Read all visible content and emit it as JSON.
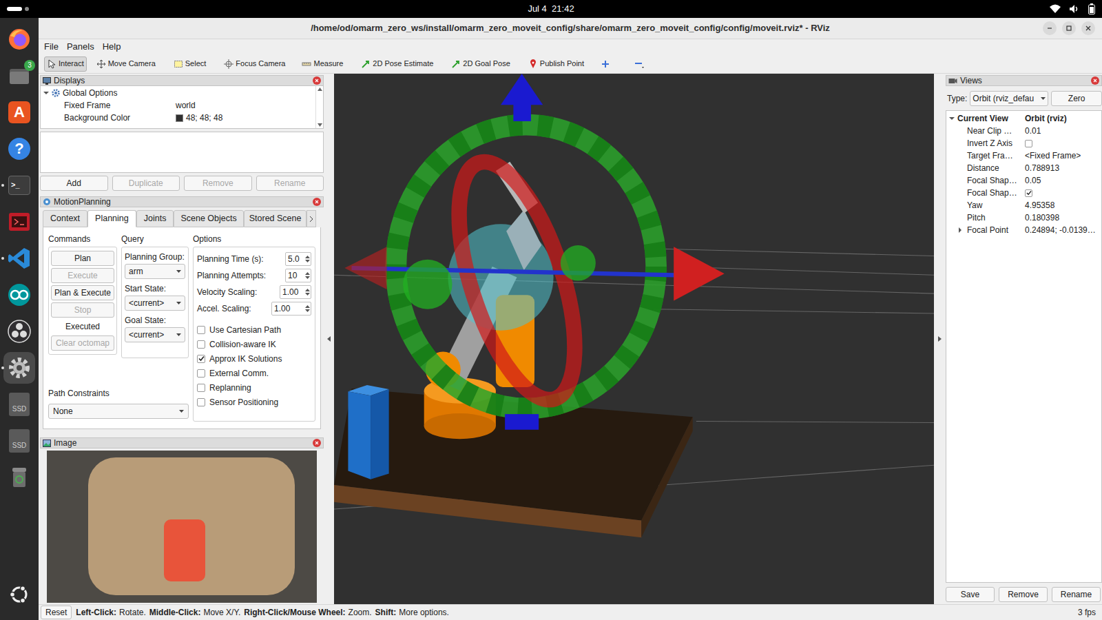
{
  "topbar": {
    "clock": "Jul 4  21:42"
  },
  "dock": {
    "badge": "3",
    "items": [
      {
        "running": false,
        "selected": false
      },
      {
        "running": false,
        "selected": false
      },
      {
        "running": false,
        "selected": false,
        "glyph": "A"
      },
      {
        "running": false,
        "selected": false,
        "glyph": "?"
      },
      {
        "running": true,
        "selected": false,
        "glyph": ">_"
      },
      {
        "running": false,
        "selected": false
      },
      {
        "running": true,
        "selected": false
      },
      {
        "running": false,
        "selected": false
      },
      {
        "running": false,
        "selected": false
      },
      {
        "running": true,
        "selected": true
      },
      {
        "running": false,
        "selected": false,
        "label": "SSD"
      },
      {
        "running": false,
        "selected": false,
        "label": "SSD"
      },
      {
        "running": false,
        "selected": false
      }
    ]
  },
  "window": {
    "title": "/home/od/omarm_zero_ws/install/omarm_zero_moveit_config/share/omarm_zero_moveit_config/config/moveit.rviz* - RViz"
  },
  "menu": [
    "File",
    "Panels",
    "Help"
  ],
  "toolbar": [
    {
      "label": "Interact",
      "selected": true
    },
    {
      "label": "Move Camera",
      "selected": false
    },
    {
      "label": "Select",
      "selected": false
    },
    {
      "label": "Focus Camera",
      "selected": false
    },
    {
      "label": "Measure",
      "selected": false
    },
    {
      "label": "2D Pose Estimate",
      "selected": false
    },
    {
      "label": "2D Goal Pose",
      "selected": false
    },
    {
      "label": "Publish Point",
      "selected": false
    }
  ],
  "displays": {
    "title": "Displays",
    "tree": [
      {
        "kind": "group",
        "label": "Global Options",
        "expanded": true
      },
      {
        "kind": "property",
        "label": "Fixed Frame",
        "value": "world"
      },
      {
        "kind": "color",
        "label": "Background Color",
        "value": "48; 48; 48",
        "color": "#303030"
      }
    ],
    "buttons": [
      {
        "label": "Add",
        "disabled": false
      },
      {
        "label": "Duplicate",
        "disabled": true
      },
      {
        "label": "Remove",
        "disabled": true
      },
      {
        "label": "Rename",
        "disabled": true
      }
    ]
  },
  "motion_planning": {
    "title": "MotionPlanning",
    "tabs": [
      {
        "label": "Context",
        "selected": false
      },
      {
        "label": "Planning",
        "selected": true
      },
      {
        "label": "Joints",
        "selected": false
      },
      {
        "label": "Scene Objects",
        "selected": false
      },
      {
        "label": "Stored Scene",
        "selected": false
      }
    ],
    "commands": {
      "heading": "Commands",
      "buttons": [
        {
          "label": "Plan",
          "disabled": false
        },
        {
          "label": "Execute",
          "disabled": true
        },
        {
          "label": "Plan & Execute",
          "disabled": false
        },
        {
          "label": "Stop",
          "disabled": true
        }
      ],
      "status": "Executed",
      "clear": {
        "label": "Clear octomap",
        "disabled": true
      }
    },
    "query": {
      "heading": "Query",
      "fields": [
        {
          "label": "Planning Group:",
          "value": "arm"
        },
        {
          "label": "Start State:",
          "value": "<current>"
        },
        {
          "label": "Goal State:",
          "value": "<current>"
        }
      ]
    },
    "options": {
      "heading": "Options",
      "spins": [
        {
          "label": "Planning Time (s):",
          "value": "5.0"
        },
        {
          "label": "Planning Attempts:",
          "value": "10"
        },
        {
          "label": "Velocity Scaling:",
          "value": "1.00"
        },
        {
          "label": "Accel. Scaling:",
          "value": "1.00"
        }
      ],
      "checks": [
        {
          "label": "Use Cartesian Path",
          "checked": false
        },
        {
          "label": "Collision-aware IK",
          "checked": false
        },
        {
          "label": "Approx IK Solutions",
          "checked": true
        },
        {
          "label": "External Comm.",
          "checked": false
        },
        {
          "label": "Replanning",
          "checked": false
        },
        {
          "label": "Sensor Positioning",
          "checked": false
        }
      ]
    },
    "path_constraints": {
      "label": "Path Constraints",
      "value": "None"
    }
  },
  "image_panel": {
    "title": "Image"
  },
  "views": {
    "title": "Views",
    "type_label": "Type:",
    "type_value": "Orbit (rviz_defau",
    "zero": "Zero",
    "header": {
      "label": "Current View",
      "value": "Orbit (rviz)",
      "expanded": true
    },
    "props": [
      {
        "kind": "text",
        "label": "Near Clip …",
        "value": "0.01"
      },
      {
        "kind": "check",
        "label": "Invert Z Axis",
        "checked": false
      },
      {
        "kind": "text",
        "label": "Target Fra…",
        "value": "<Fixed Frame>"
      },
      {
        "kind": "text",
        "label": "Distance",
        "value": "0.788913"
      },
      {
        "kind": "text",
        "label": "Focal Shap…",
        "value": "0.05"
      },
      {
        "kind": "check",
        "label": "Focal Shap…",
        "checked": true
      },
      {
        "kind": "text",
        "label": "Yaw",
        "value": "4.95358"
      },
      {
        "kind": "text",
        "label": "Pitch",
        "value": "0.180398"
      },
      {
        "kind": "group",
        "label": "Focal Point",
        "value": "0.24894; -0.0139…",
        "expanded": false
      }
    ],
    "buttons": [
      "Save",
      "Remove",
      "Rename"
    ]
  },
  "status_bar": {
    "reset": "Reset",
    "hints": [
      {
        "key": "Left-Click:",
        "text": "Rotate."
      },
      {
        "key": "Middle-Click:",
        "text": "Move X/Y."
      },
      {
        "key": "Right-Click/Mouse Wheel:",
        "text": "Zoom."
      },
      {
        "key": "Shift:",
        "text": "More options."
      }
    ],
    "fps": "3 fps"
  }
}
